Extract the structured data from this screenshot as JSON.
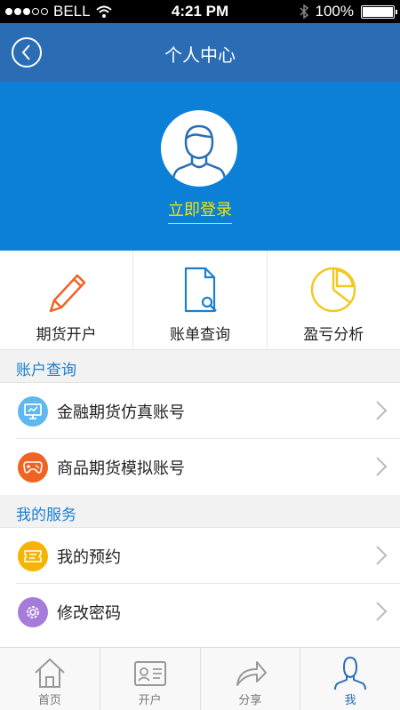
{
  "status_bar": {
    "carrier": "BELL",
    "time": "4:21 PM",
    "battery": "100%"
  },
  "nav": {
    "title": "个人中心",
    "back_icon": "chevron-left-icon"
  },
  "profile": {
    "login_label": "立即登录",
    "avatar_icon": "user-avatar-icon"
  },
  "quick_actions": [
    {
      "label": "期货开户",
      "icon": "pencil-icon"
    },
    {
      "label": "账单查询",
      "icon": "document-search-icon"
    },
    {
      "label": "盈亏分析",
      "icon": "pie-chart-icon"
    }
  ],
  "sections": [
    {
      "title": "账户查询",
      "items": [
        {
          "label": "金融期货仿真账号",
          "icon": "monitor-icon",
          "color": "#5fb8f0"
        },
        {
          "label": "商品期货模拟账号",
          "icon": "gamepad-icon",
          "color": "#f26222"
        }
      ]
    },
    {
      "title": "我的服务",
      "items": [
        {
          "label": "我的预约",
          "icon": "ticket-icon",
          "color": "#f5b400"
        },
        {
          "label": "修改密码",
          "icon": "gear-icon",
          "color": "#a57cd9"
        }
      ]
    }
  ],
  "tabs": [
    {
      "label": "首页",
      "icon": "home-icon",
      "active": false
    },
    {
      "label": "开户",
      "icon": "id-card-icon",
      "active": false
    },
    {
      "label": "分享",
      "icon": "share-icon",
      "active": false
    },
    {
      "label": "我",
      "icon": "person-icon",
      "active": true
    }
  ],
  "colors": {
    "nav_bg": "#2a6db4",
    "profile_bg": "#0b80d6",
    "login_text": "#f2e400",
    "section_text": "#1a7fd0"
  }
}
